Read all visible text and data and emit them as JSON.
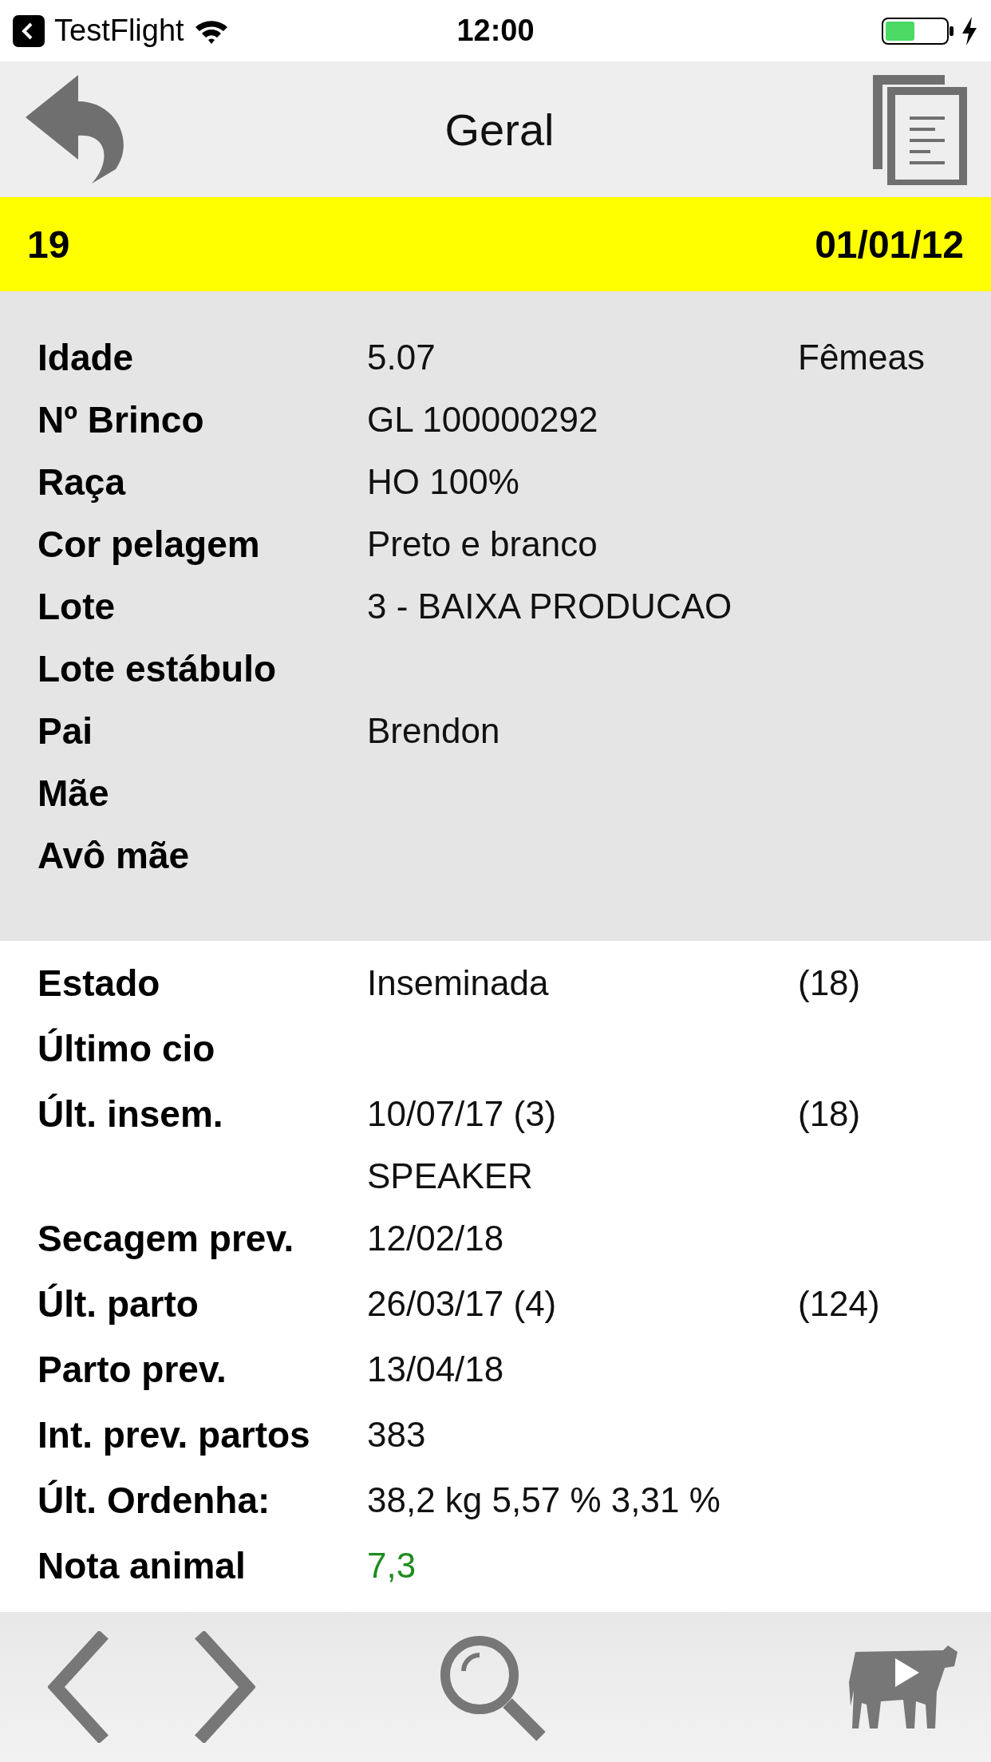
{
  "status_bar": {
    "back_app": "TestFlight",
    "time": "12:00"
  },
  "header": {
    "title": "Geral"
  },
  "id_bar": {
    "number": "19",
    "date": "01/01/12"
  },
  "general": [
    {
      "label": "Idade",
      "values": [
        "5.07"
      ],
      "extra": "Fêmeas"
    },
    {
      "label": "Nº Brinco",
      "values": [
        "GL 100000292"
      ]
    },
    {
      "label": "Raça",
      "values": [
        "HO 100%"
      ]
    },
    {
      "label": "Cor pelagem",
      "values": [
        "Preto e branco"
      ]
    },
    {
      "label": "Lote",
      "values": [
        "3 - BAIXA PRODUCAO"
      ]
    },
    {
      "label": "Lote estábulo"
    },
    {
      "label": "Pai",
      "values": [
        "Brendon"
      ]
    },
    {
      "label": "Mãe"
    },
    {
      "label": "Avô mãe"
    }
  ],
  "reproduction": [
    {
      "label": "Estado",
      "values": [
        "Inseminada"
      ],
      "extra": "(18)"
    },
    {
      "label": "Último cio"
    },
    {
      "label": "Últ. insem.",
      "values": [
        "10/07/17 (3)",
        "SPEAKER"
      ],
      "extra": "(18)"
    },
    {
      "label": "Secagem prev.",
      "values": [
        "12/02/18"
      ]
    },
    {
      "label": "Últ. parto",
      "values": [
        "26/03/17 (4)"
      ],
      "extra": "(124)"
    },
    {
      "label": "Parto prev.",
      "values": [
        "13/04/18"
      ]
    },
    {
      "label": "Int. prev. partos",
      "values": [
        "383"
      ]
    },
    {
      "label": "Últ. Ordenha:",
      "values": [
        "38,2 kg 5,57 %  3,31 %"
      ]
    },
    {
      "label": "Nota animal",
      "values": [
        "7,3"
      ],
      "color": "#1e8c1e"
    }
  ]
}
